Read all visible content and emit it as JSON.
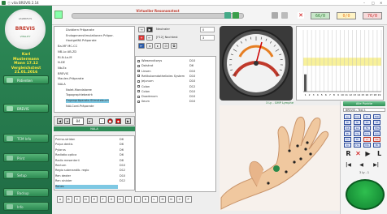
{
  "window": {
    "title": "ⓥ vita BREVIS 2.14",
    "controls": [
      "–",
      "□",
      "✕"
    ]
  },
  "logo": {
    "arc": "vitaBREVIS",
    "brand": "BREVIS",
    "sub": "VITALITY"
  },
  "user": {
    "first": "Karl",
    "last": "Mustermann",
    "birth_label": "Mann  17.12",
    "program": "Vergleichstest",
    "date": "21.01.2016"
  },
  "nav": [
    {
      "label": "Patienten"
    },
    {
      "label": "BREVIS"
    },
    {
      "label": "TCM Info"
    },
    {
      "label": "Print"
    },
    {
      "label": "Setup"
    },
    {
      "label": "Backup"
    },
    {
      "label": "Info"
    }
  ],
  "toolbar": {
    "section_title": "Virtueller Resonanztest",
    "progress_label": "██████████",
    "counters": [
      {
        "value": "66/0",
        "color": "#2e7d32",
        "bg": "#c8e6c9"
      },
      {
        "value": "0/0",
        "color": "#e67e22",
        "bg": "#fff3c4"
      },
      {
        "value": "76/0",
        "color": "#c62828",
        "bg": "#f7dada"
      }
    ]
  },
  "tree": [
    "Dividiern Präparate",
    "Endogenenstimulationen Präpar.",
    "Hautgefäß Präparate",
    "Ba-MF MC-CC",
    "NB-Lo AB-ZD",
    "RI-N-Lo-M",
    "N-DE",
    "Nb-Ex",
    "BREVIS",
    "Maulen-Präparate",
    "NALA",
    "Nalet-Mandalaree",
    "Topographiebezirk",
    "Organpräparate-Stirnstebuch",
    "NALCord-Präparate"
  ],
  "tree_selected": "Organpräparate-Stirnstebuch",
  "stepper": {
    "value": "84"
  },
  "list_header": "NALA",
  "list": [
    {
      "name": "Pulmo-stridan",
      "code": "D6"
    },
    {
      "name": "Pulpa dentis",
      "code": "D6"
    },
    {
      "name": "Pylorus",
      "code": "D6"
    },
    {
      "name": "Radiatio optica",
      "code": "D6"
    },
    {
      "name": "Radix mesenterii",
      "code": "D8"
    },
    {
      "name": "Rectum",
      "code": "D10"
    },
    {
      "name": "Regio submandib. regio",
      "code": "D12"
    },
    {
      "name": "Ren dexter",
      "code": "D10"
    },
    {
      "name": "Ren sinister",
      "code": "D12"
    },
    {
      "name": "Renes",
      "code": ""
    }
  ],
  "list_selected": "Renes",
  "alphabet": [
    "A",
    "B",
    "C",
    "D",
    "E",
    "F",
    "G",
    "H",
    "I",
    "J",
    "K",
    "L",
    "M",
    "N",
    "O",
    "P"
  ],
  "test_panel": {
    "mode": "Neutraler",
    "field1": "0",
    "code": "[F12]  Nachtest",
    "field2": "3"
  },
  "results": [
    {
      "name": "Wiesenvitorys",
      "val": "D10"
    },
    {
      "name": "Dalstrat",
      "val": "D6"
    },
    {
      "name": "Linsen",
      "val": "D10"
    },
    {
      "name": "Retikuloendotheliales System",
      "val": "D10"
    },
    {
      "name": "Jejunum",
      "val": "D10"
    },
    {
      "name": "Colon",
      "val": "D12"
    },
    {
      "name": "Colon",
      "val": "D10"
    },
    {
      "name": "Duodenum",
      "val": "D10"
    },
    {
      "name": "Ileum",
      "val": "D10"
    }
  ],
  "gauge_caption": "3 Ly - GMP Lymphe",
  "chart_data": {
    "type": "bar",
    "categories": [
      "1",
      "2",
      "3",
      "4",
      "5",
      "6",
      "7",
      "8",
      "9",
      "10",
      "11",
      "12",
      "13",
      "14",
      "15",
      "16",
      "17",
      "18",
      "19"
    ],
    "values": [
      0.28,
      0,
      0,
      0,
      0,
      0,
      0,
      0,
      0,
      0,
      0,
      0,
      0,
      0,
      0,
      0,
      0,
      0,
      0
    ],
    "xlabel": "",
    "ylabel": "",
    "band": {
      "low": 0.42,
      "high": 0.55,
      "color": "#f8f19a"
    }
  },
  "right_panel": {
    "header": "Alle Punkte",
    "dropdown": "BREVIS - Test 1",
    "labels": [
      "Lu",
      "Dü",
      "Di",
      "MD",
      "Bl",
      "Ni",
      "KS",
      "3E",
      "Gb",
      "Le",
      "Fa",
      "Ma",
      "Mi",
      "He",
      "Dü",
      "GG",
      "KG",
      "Bl",
      "Ar",
      "Ne",
      "Ly",
      "Hu",
      "Mp",
      "Pk"
    ],
    "red_labels": [
      "Ar",
      "Ne"
    ],
    "controls": [
      "R",
      "✕",
      "▶",
      "L"
    ],
    "nav": [
      "|◀",
      "◀",
      "▶|"
    ],
    "caption": "3 Ly - 1"
  }
}
